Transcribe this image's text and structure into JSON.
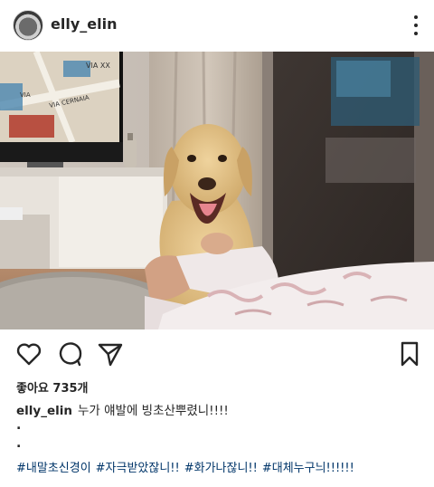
{
  "post": {
    "username": "elly_elin",
    "likes_text": "좋아요 735개",
    "caption_user": "elly_elin",
    "caption_text": "누가 얘발에 빙초산뿌렸니!!!!",
    "line_dots": [
      ".",
      "."
    ],
    "hashtags": [
      "#내말초신경이",
      "#자극받았잖니!!",
      "#화가나잖니!!",
      "#대체누구늬!!!!!!"
    ]
  },
  "icons": {
    "more": "more-vertical-icon",
    "like": "heart-icon",
    "comment": "comment-icon",
    "share": "send-icon",
    "save": "bookmark-icon"
  },
  "photo": {
    "tv_screen_text": "VIA XX",
    "tv_map_labels": [
      "VIA CERNAIA",
      "VIA"
    ]
  }
}
